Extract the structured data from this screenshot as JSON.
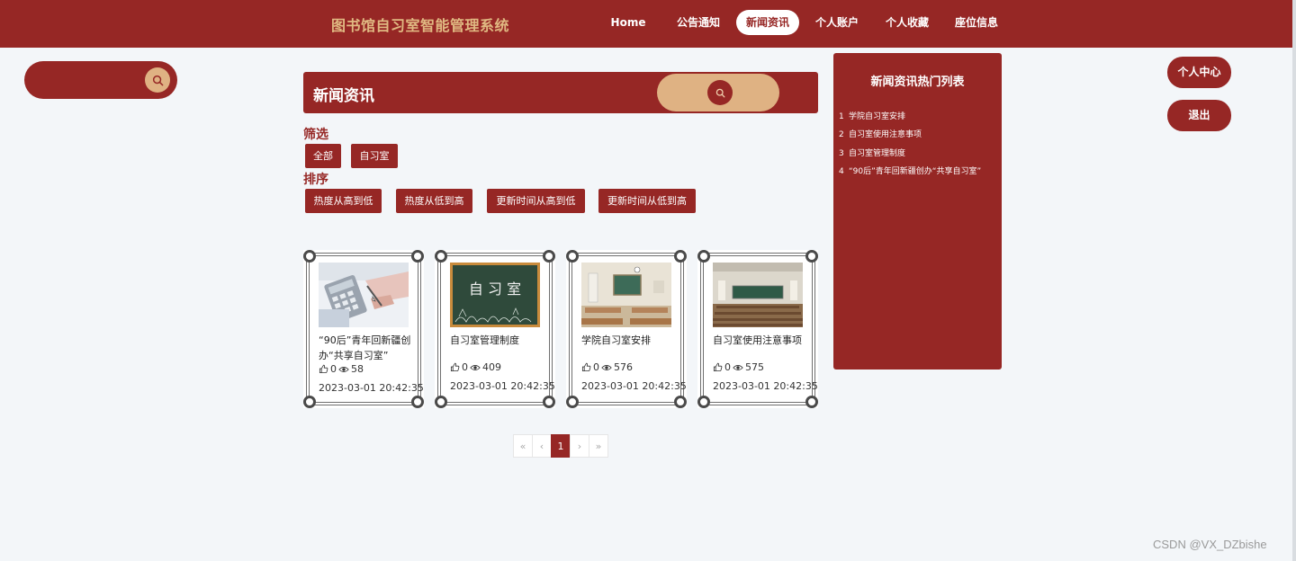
{
  "header": {
    "site_title": "图书馆自习室智能管理系统",
    "nav": [
      {
        "label": "Home",
        "active": false
      },
      {
        "label": "公告通知",
        "active": false
      },
      {
        "label": "新闻资讯",
        "active": true
      },
      {
        "label": "个人账户",
        "active": false
      },
      {
        "label": "个人收藏",
        "active": false
      },
      {
        "label": "座位信息",
        "active": false
      }
    ]
  },
  "left_search": {
    "placeholder": "",
    "icon": "search-icon"
  },
  "news": {
    "title": "新闻资讯",
    "search_placeholder": "",
    "filter_label": "筛选",
    "filters": [
      "全部",
      "自习室"
    ],
    "sort_label": "排序",
    "sorts": [
      "热度从高到低",
      "热度从低到高",
      "更新时间从高到低",
      "更新时间从低到高"
    ]
  },
  "cards": [
    {
      "title": "“90后”青年回新疆创办“共享自习室”",
      "likes": "0",
      "views": "58",
      "date": "2023-03-01 20:42:35",
      "image": "calculator-desk"
    },
    {
      "title": "自习室管理制度",
      "likes": "0",
      "views": "409",
      "date": "2023-03-01 20:42:35",
      "image": "chalkboard"
    },
    {
      "title": "学院自习室安排",
      "likes": "0",
      "views": "576",
      "date": "2023-03-01 20:42:35",
      "image": "classroom"
    },
    {
      "title": "自习室使用注意事项",
      "likes": "0",
      "views": "575",
      "date": "2023-03-01 20:42:35",
      "image": "lecture-hall"
    }
  ],
  "pagination": {
    "first": "«",
    "prev": "‹",
    "current": "1",
    "next": "›",
    "last": "»"
  },
  "hot_list": {
    "title": "新闻资讯热门列表",
    "items": [
      {
        "num": "1",
        "title": "学院自习室安排"
      },
      {
        "num": "2",
        "title": "自习室使用注意事项"
      },
      {
        "num": "3",
        "title": "自习室管理制度"
      },
      {
        "num": "4",
        "title": "“90后”青年回新疆创办“共享自习室”"
      }
    ]
  },
  "side_buttons": {
    "center": "个人中心",
    "logout": "退出"
  },
  "watermark": "CSDN @VX_DZbishe",
  "colors": {
    "primary": "#962725",
    "accent": "#dfb283",
    "title_gold": "#e0b982",
    "background": "#f3f6f9"
  }
}
